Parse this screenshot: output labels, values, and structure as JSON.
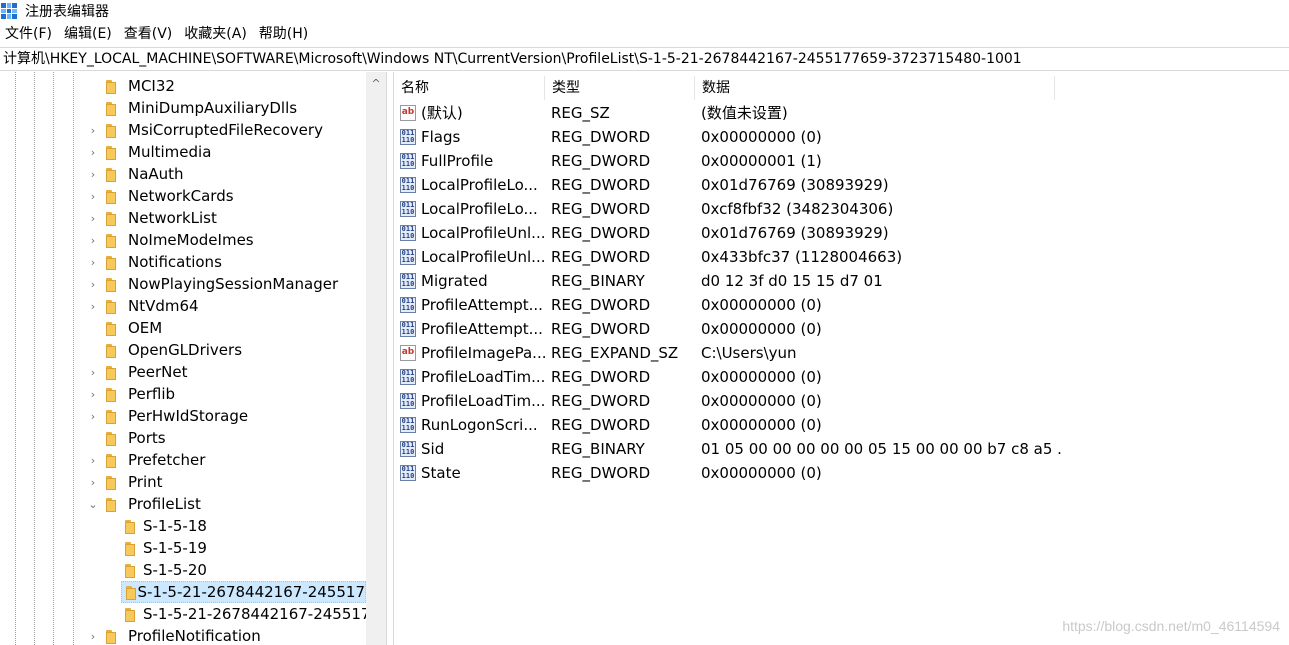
{
  "window": {
    "title": "注册表编辑器"
  },
  "menu": [
    "文件(F)",
    "编辑(E)",
    "查看(V)",
    "收藏夹(A)",
    "帮助(H)"
  ],
  "address": "计算机\\HKEY_LOCAL_MACHINE\\SOFTWARE\\Microsoft\\Windows NT\\CurrentVersion\\ProfileList\\S-1-5-21-2678442167-2455177659-3723715480-1001",
  "tree": {
    "items": [
      {
        "label": "MCI32",
        "expander": ""
      },
      {
        "label": "MiniDumpAuxiliaryDlls",
        "expander": ""
      },
      {
        "label": "MsiCorruptedFileRecovery",
        "expander": "›"
      },
      {
        "label": "Multimedia",
        "expander": "›"
      },
      {
        "label": "NaAuth",
        "expander": "›"
      },
      {
        "label": "NetworkCards",
        "expander": "›"
      },
      {
        "label": "NetworkList",
        "expander": "›"
      },
      {
        "label": "NoImeModeImes",
        "expander": "›"
      },
      {
        "label": "Notifications",
        "expander": "›"
      },
      {
        "label": "NowPlayingSessionManager",
        "expander": "›"
      },
      {
        "label": "NtVdm64",
        "expander": "›"
      },
      {
        "label": "OEM",
        "expander": ""
      },
      {
        "label": "OpenGLDrivers",
        "expander": ""
      },
      {
        "label": "PeerNet",
        "expander": "›"
      },
      {
        "label": "Perflib",
        "expander": "›"
      },
      {
        "label": "PerHwIdStorage",
        "expander": "›"
      },
      {
        "label": "Ports",
        "expander": ""
      },
      {
        "label": "Prefetcher",
        "expander": "›"
      },
      {
        "label": "Print",
        "expander": "›"
      },
      {
        "label": "ProfileList",
        "expander": "⌄"
      },
      {
        "label": "S-1-5-18",
        "expander": ""
      },
      {
        "label": "S-1-5-19",
        "expander": ""
      },
      {
        "label": "S-1-5-20",
        "expander": ""
      },
      {
        "label": "S-1-5-21-2678442167-245517",
        "expander": ""
      },
      {
        "label": "S-1-5-21-2678442167-245517",
        "expander": ""
      },
      {
        "label": "ProfileNotification",
        "expander": "›"
      }
    ],
    "scroll_up": "^"
  },
  "values": {
    "headers": {
      "name": "名称",
      "type": "类型",
      "data": "数据"
    },
    "rows": [
      {
        "icon": "ab",
        "name": "(默认)",
        "type": "REG_SZ",
        "data": "(数值未设置)"
      },
      {
        "icon": "bin",
        "name": "Flags",
        "type": "REG_DWORD",
        "data": "0x00000000 (0)"
      },
      {
        "icon": "bin",
        "name": "FullProfile",
        "type": "REG_DWORD",
        "data": "0x00000001 (1)"
      },
      {
        "icon": "bin",
        "name": "LocalProfileLo...",
        "type": "REG_DWORD",
        "data": "0x01d76769 (30893929)"
      },
      {
        "icon": "bin",
        "name": "LocalProfileLo...",
        "type": "REG_DWORD",
        "data": "0xcf8fbf32 (3482304306)"
      },
      {
        "icon": "bin",
        "name": "LocalProfileUnl...",
        "type": "REG_DWORD",
        "data": "0x01d76769 (30893929)"
      },
      {
        "icon": "bin",
        "name": "LocalProfileUnl...",
        "type": "REG_DWORD",
        "data": "0x433bfc37 (1128004663)"
      },
      {
        "icon": "bin",
        "name": "Migrated",
        "type": "REG_BINARY",
        "data": "d0 12 3f d0 15 15 d7 01"
      },
      {
        "icon": "bin",
        "name": "ProfileAttempt...",
        "type": "REG_DWORD",
        "data": "0x00000000 (0)"
      },
      {
        "icon": "bin",
        "name": "ProfileAttempt...",
        "type": "REG_DWORD",
        "data": "0x00000000 (0)"
      },
      {
        "icon": "ab",
        "name": "ProfileImagePa...",
        "type": "REG_EXPAND_SZ",
        "data": "C:\\Users\\yun"
      },
      {
        "icon": "bin",
        "name": "ProfileLoadTim...",
        "type": "REG_DWORD",
        "data": "0x00000000 (0)"
      },
      {
        "icon": "bin",
        "name": "ProfileLoadTim...",
        "type": "REG_DWORD",
        "data": "0x00000000 (0)"
      },
      {
        "icon": "bin",
        "name": "RunLogonScri...",
        "type": "REG_DWORD",
        "data": "0x00000000 (0)"
      },
      {
        "icon": "bin",
        "name": "Sid",
        "type": "REG_BINARY",
        "data": "01 05 00 00 00 00 00 05 15 00 00 00 b7 c8 a5 ..."
      },
      {
        "icon": "bin",
        "name": "State",
        "type": "REG_DWORD",
        "data": "0x00000000 (0)"
      }
    ]
  },
  "icons": {
    "ab_text": "ab",
    "bin_text": "011 110"
  },
  "watermark": "https://blog.csdn.net/m0_46114594",
  "colors": {
    "selection": "#cce8ff",
    "folder": "#f6c95a",
    "accent": "#1d6fd0"
  }
}
